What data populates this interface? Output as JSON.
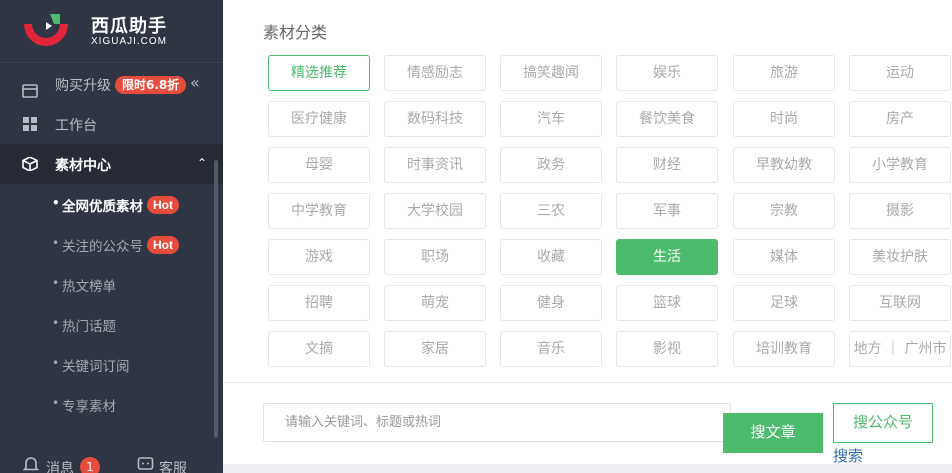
{
  "brand": {
    "name": "西瓜助手",
    "domain": "XIGUAJI.COM"
  },
  "sidebar": {
    "upgrade": {
      "label": "购买升级",
      "badge": "限时6.8折",
      "collapse_icon": "double-chevron-left-icon"
    },
    "workbench": {
      "label": "工作台"
    },
    "material_center": {
      "label": "素材中心"
    },
    "sub_items": [
      {
        "label": "全网优质素材",
        "badge": "Hot"
      },
      {
        "label": "关注的公众号",
        "badge": "Hot"
      },
      {
        "label": "热文榜单"
      },
      {
        "label": "热门话题"
      },
      {
        "label": "关键词订阅"
      },
      {
        "label": "专享素材"
      }
    ],
    "bottom": {
      "messages": "消息",
      "messages_count": "1",
      "service": "客服"
    }
  },
  "main": {
    "section_title": "素材分类",
    "categories": [
      [
        "精选推荐",
        "情感励志",
        "搞笑趣闻",
        "娱乐",
        "旅游",
        "运动"
      ],
      [
        "医疗健康",
        "数码科技",
        "汽车",
        "餐饮美食",
        "时尚",
        "房产"
      ],
      [
        "母婴",
        "时事资讯",
        "政务",
        "财经",
        "早教幼教",
        "小学教育"
      ],
      [
        "中学教育",
        "大学校园",
        "三农",
        "军事",
        "宗教",
        "摄影"
      ],
      [
        "游戏",
        "职场",
        "收藏",
        "生活",
        "媒体",
        "美妆护肤"
      ],
      [
        "招聘",
        "萌宠",
        "健身",
        "篮球",
        "足球",
        "互联网"
      ],
      [
        "文摘",
        "家居",
        "音乐",
        "影视",
        "培训教育",
        "地方 ｜ 广州市"
      ]
    ],
    "search": {
      "placeholder": "请输入关键词、标题或热词",
      "article_button": "搜文章",
      "account_button": "搜公众号",
      "link": "搜索"
    }
  },
  "colors": {
    "accent": "#4cbb6c",
    "sidebar_bg": "#2f3542",
    "badge": "#e74c3c"
  }
}
